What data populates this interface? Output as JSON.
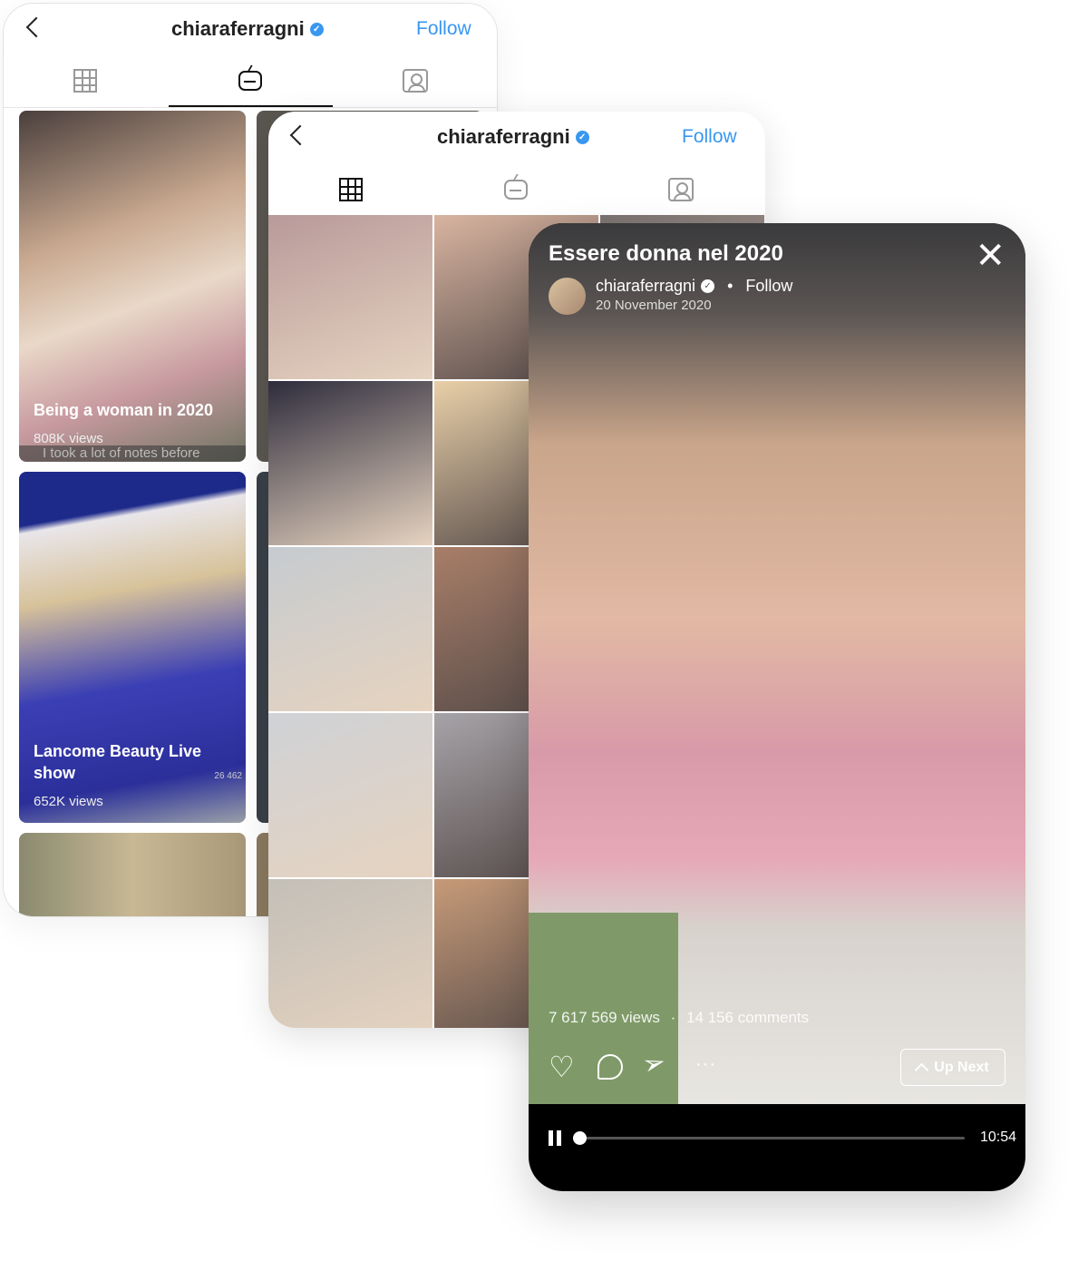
{
  "profile_screen": {
    "username": "chiaraferragni",
    "follow_label": "Follow",
    "tabs": [
      "grid",
      "igtv",
      "tagged"
    ],
    "active_tab": "igtv",
    "cards": [
      {
        "title": "Being a woman in 2020",
        "views": "808K views",
        "caption": "I took a lot of notes before"
      },
      {
        "title": "Lancome Beauty Live show",
        "views": "652K views",
        "overlay_text": "26 462"
      }
    ]
  },
  "grid_screen": {
    "username": "chiaraferragni",
    "follow_label": "Follow",
    "tabs": [
      "grid",
      "igtv",
      "tagged"
    ],
    "active_tab": "grid"
  },
  "video_screen": {
    "title": "Essere donna nel 2020",
    "username": "chiaraferragni",
    "separator": "•",
    "follow_label": "Follow",
    "date": "20 November 2020",
    "views": "7 617 569 views",
    "dot": "·",
    "comments": "14 156 comments",
    "more": "···",
    "up_next_label": "Up Next",
    "duration": "10:54",
    "progress": 0.0
  },
  "colors": {
    "accent": "#3897f0"
  }
}
